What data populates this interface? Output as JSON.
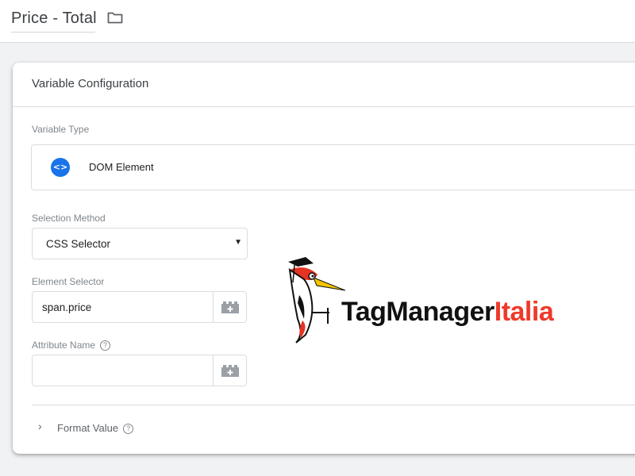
{
  "header": {
    "title": "Price - Total",
    "folder_icon": "folder-icon"
  },
  "card": {
    "title": "Variable Configuration",
    "variable_type": {
      "label": "Variable Type",
      "value": "DOM Element",
      "icon": "code-brackets-icon",
      "icon_glyph": "<>",
      "icon_color": "#1a73e8"
    },
    "selection_method": {
      "label": "Selection Method",
      "value": "CSS Selector"
    },
    "element_selector": {
      "label": "Element Selector",
      "value": "span.price",
      "button_icon": "variable-lego-icon"
    },
    "attribute_name": {
      "label": "Attribute Name",
      "value": "",
      "help_icon": "help-icon",
      "button_icon": "variable-lego-icon"
    },
    "format_value": {
      "label": "Format Value",
      "help_icon": "help-icon"
    }
  },
  "watermark": {
    "text_dark": "TagManager",
    "text_red": "Italia",
    "red_color": "#ee3a2b"
  }
}
